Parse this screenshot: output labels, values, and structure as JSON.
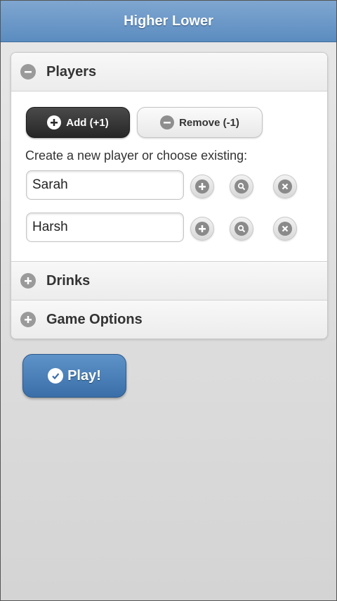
{
  "header": {
    "title": "Higher Lower"
  },
  "sections": {
    "players": {
      "title": "Players",
      "icon": "minus-icon",
      "expanded": true
    },
    "drinks": {
      "title": "Drinks",
      "icon": "plus-icon",
      "expanded": false
    },
    "game_options": {
      "title": "Game Options",
      "icon": "plus-icon",
      "expanded": false
    }
  },
  "players_panel": {
    "add_label": "Add (+1)",
    "remove_label": "Remove (-1)",
    "prompt": "Create a new player or choose existing:",
    "rows": [
      {
        "name": "Sarah"
      },
      {
        "name": "Harsh"
      }
    ]
  },
  "play_button": {
    "label": "Play!"
  },
  "colors": {
    "header": "#5b8cc0",
    "play": "#3a6ea8",
    "add_button": "#262626"
  }
}
